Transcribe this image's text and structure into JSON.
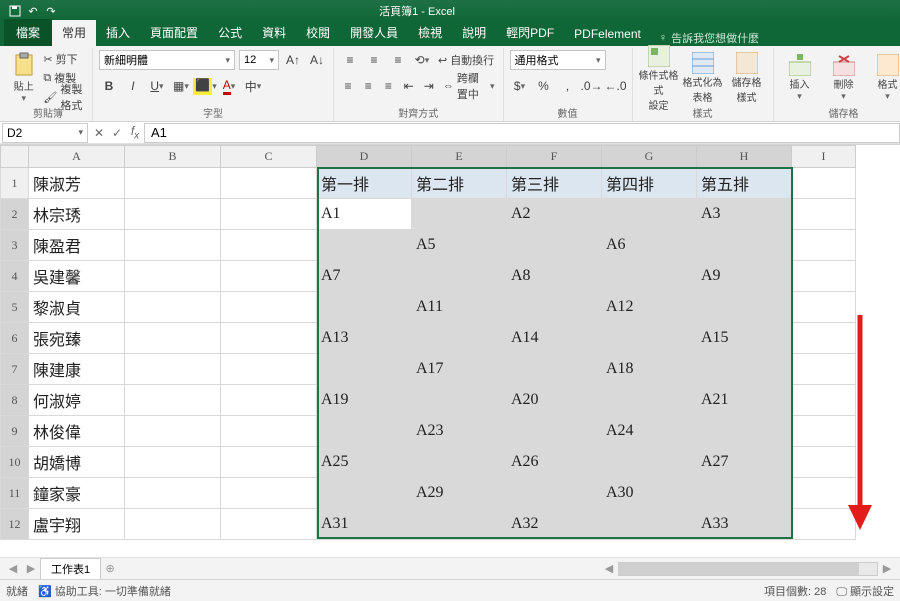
{
  "app": {
    "title": "活頁簿1 - Excel"
  },
  "tabs": {
    "file": "檔案",
    "home": "常用",
    "insert": "插入",
    "layout": "頁面配置",
    "formulas": "公式",
    "data": "資料",
    "review": "校閱",
    "developer": "開發人員",
    "view": "檢視",
    "help": "說明",
    "pdf": "輕閃PDF",
    "pdfe": "PDFelement",
    "tellme": "告訴我您想做什麼"
  },
  "clip": {
    "group": "剪貼簿",
    "paste": "貼上",
    "cut": "剪下",
    "copy": "複製",
    "painter": "複製格式"
  },
  "font": {
    "group": "字型",
    "name": "新細明體",
    "size": "12"
  },
  "align": {
    "group": "對齊方式",
    "wrap": "自動換行",
    "merge": "跨欄置中"
  },
  "number": {
    "group": "數值",
    "format": "通用格式"
  },
  "styles": {
    "group": "樣式",
    "cond": "條件式格式\n設定",
    "table": "格式化為\n表格",
    "cell": "儲存格\n樣式"
  },
  "cells": {
    "group": "儲存格",
    "insert": "插入",
    "delete": "刪除",
    "format": "格式"
  },
  "namebox": "D2",
  "formula": "A1",
  "columns": [
    "A",
    "B",
    "C",
    "D",
    "E",
    "F",
    "G",
    "H",
    "I"
  ],
  "rows": [
    {
      "n": "1",
      "A": "陳淑芳",
      "D": "第一排",
      "E": "第二排",
      "F": "第三排",
      "G": "第四排",
      "H": "第五排",
      "hdr": true
    },
    {
      "n": "2",
      "A": "林宗琇",
      "D": "A1",
      "E": "",
      "F": "A2",
      "G": "",
      "H": "A3"
    },
    {
      "n": "3",
      "A": "陳盈君",
      "D": "",
      "E": "A5",
      "F": "",
      "G": "A6",
      "H": ""
    },
    {
      "n": "4",
      "A": "吳建馨",
      "D": "A7",
      "E": "",
      "F": "A8",
      "G": "",
      "H": "A9"
    },
    {
      "n": "5",
      "A": "黎淑貞",
      "D": "",
      "E": "A11",
      "F": "",
      "G": "A12",
      "H": ""
    },
    {
      "n": "6",
      "A": "張宛臻",
      "D": "A13",
      "E": "",
      "F": "A14",
      "G": "",
      "H": "A15"
    },
    {
      "n": "7",
      "A": "陳建康",
      "D": "",
      "E": "A17",
      "F": "",
      "G": "A18",
      "H": ""
    },
    {
      "n": "8",
      "A": "何淑婷",
      "D": "A19",
      "E": "",
      "F": "A20",
      "G": "",
      "H": "A21"
    },
    {
      "n": "9",
      "A": "林俊偉",
      "D": "",
      "E": "A23",
      "F": "",
      "G": "A24",
      "H": ""
    },
    {
      "n": "10",
      "A": "胡嬌博",
      "D": "A25",
      "E": "",
      "F": "A26",
      "G": "",
      "H": "A27"
    },
    {
      "n": "11",
      "A": "鐘家豪",
      "D": "",
      "E": "A29",
      "F": "",
      "G": "A30",
      "H": ""
    },
    {
      "n": "12",
      "A": "盧宇翔",
      "D": "A31",
      "E": "",
      "F": "A32",
      "G": "",
      "H": "A33"
    }
  ],
  "sheet": {
    "name": "工作表1"
  },
  "status": {
    "ready": "就緒",
    "acc": "協助工具: 一切準備就緒",
    "count": "項目個數: 28",
    "display": "顯示設定"
  }
}
